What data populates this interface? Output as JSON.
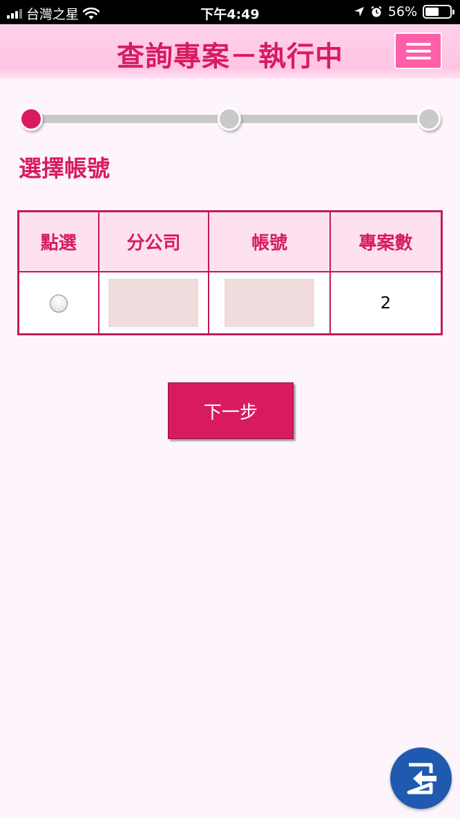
{
  "status_bar": {
    "carrier": "台灣之星",
    "time": "下午4:49",
    "battery": "56%",
    "battery_level": 0.56
  },
  "header": {
    "title": "查詢專案－執行中",
    "menu_icon": "hamburger-menu-icon"
  },
  "stepper": {
    "total_steps": 3,
    "current_step": 1
  },
  "section_title": "選擇帳號",
  "table": {
    "headers": [
      "點選",
      "分公司",
      "帳號",
      "專案數"
    ],
    "rows": [
      {
        "branch": "",
        "account": "",
        "project_count": "2"
      }
    ]
  },
  "next_button": "下一步",
  "logout_icon": "logout-icon",
  "colors": {
    "accent": "#d81b60",
    "header_bg": "#ffc4e3",
    "menu_button": "#ff5ea8",
    "logout_button": "#1f5ab0"
  }
}
